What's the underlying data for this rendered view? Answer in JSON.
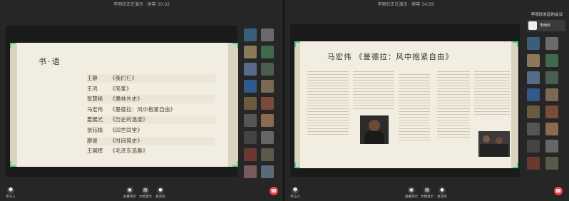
{
  "left": {
    "topbar_title": "李雨欣正在演示 · 屏幕 30:32",
    "slide_title": "书·语",
    "books": [
      {
        "author": "王静",
        "title": "《我们仨》"
      },
      {
        "author": "王鸿",
        "title": "《简爱》"
      },
      {
        "author": "张慧艳",
        "title": "《儒林外史》"
      },
      {
        "author": "马宏伟",
        "title": "《曼德拉：风中抱紧自由》"
      },
      {
        "author": "姜展光",
        "title": "《历史的温度》"
      },
      {
        "author": "张钰婧",
        "title": "《四世同堂》"
      },
      {
        "author": "廖俊",
        "title": "《时间简史》"
      },
      {
        "author": "王国辉",
        "title": "《毛泽东选集》"
      }
    ],
    "controls": {
      "participants": "参与人",
      "screen": "屏幕演示",
      "doc": "文档演示",
      "mic": "麦克风"
    }
  },
  "right": {
    "topbar_title": "李雨欣正在演示 · 屏幕 34:59",
    "meeting_title": "李雨欣发起的会议",
    "host_name": "李雨欣",
    "slide_title": "马宏伟 《曼德拉：风中抱紧自由》",
    "controls": {
      "participants": "参与人",
      "screen": "屏幕演示",
      "doc": "文档演示",
      "mic": "麦克风"
    }
  },
  "colors": {
    "accent": "#4fd08a",
    "leave": "#e8454a",
    "slide_bg": "#f1ede1"
  },
  "icons": {
    "participants": "person-icon",
    "screen": "monitor-icon",
    "doc": "document-icon",
    "mic": "microphone-icon",
    "leave": "phone-hangup-icon"
  }
}
